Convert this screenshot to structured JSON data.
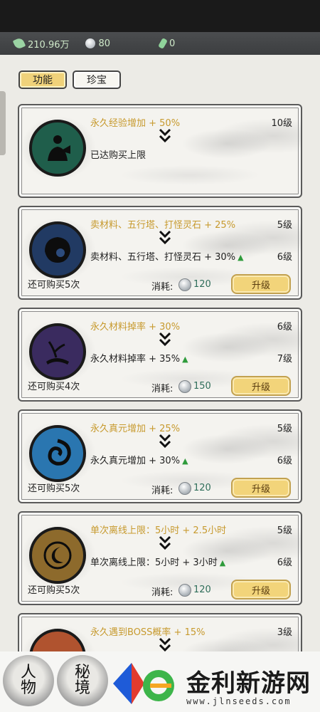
{
  "resources": [
    {
      "icon": "spirit-stone-icon",
      "value": "210.96万"
    },
    {
      "icon": "silver-stone-icon",
      "value": "80"
    },
    {
      "icon": "jade-icon",
      "value": "0"
    }
  ],
  "tabs": [
    {
      "label": "功能",
      "active": true
    },
    {
      "label": "珍宝",
      "active": false
    }
  ],
  "common": {
    "cost_label": "消耗:",
    "upgrade_label": "升级",
    "arrow_symbol": "❯❯"
  },
  "cards": [
    {
      "icon": "meditation-icon",
      "orb_color": "#1f5e4b",
      "current": "永久经验增加 + 50%",
      "current_level": "10级",
      "next": "已达购买上限",
      "next_level": "",
      "remaining": "",
      "cost": ""
    },
    {
      "icon": "shell-icon",
      "orb_color": "#213a63",
      "current": "卖材料、五行塔、打怪灵石 + 25%",
      "current_level": "5级",
      "next": "卖材料、五行塔、打怪灵石 + 30%",
      "next_level": "6级",
      "remaining": "还可购买5次",
      "cost": "120"
    },
    {
      "icon": "branch-icon",
      "orb_color": "#3a2b5f",
      "current": "永久材料掉率 + 30%",
      "current_level": "6级",
      "next": "永久材料掉率 + 35%",
      "next_level": "7级",
      "remaining": "还可购买4次",
      "cost": "150"
    },
    {
      "icon": "swirl-icon",
      "orb_color": "#2a76b0",
      "current": "永久真元增加 + 25%",
      "current_level": "5级",
      "next": "永久真元增加 + 30%",
      "next_level": "6级",
      "remaining": "还可购买5次",
      "cost": "120"
    },
    {
      "icon": "moon-clock-icon",
      "orb_color": "#8d6a2c",
      "current": "单次离线上限：5小时 + 2.5小时",
      "current_level": "5级",
      "next": "单次离线上限：5小时 + 3小时",
      "next_level": "6级",
      "remaining": "还可购买5次",
      "cost": "120"
    },
    {
      "icon": "boss-icon",
      "orb_color": "#b0532f",
      "current": "永久遇到BOSS概率 + 15%",
      "current_level": "3级",
      "next": "",
      "next_level": "",
      "remaining": "",
      "cost": ""
    }
  ],
  "bottom_nav": [
    {
      "line1": "人",
      "line2": "物"
    },
    {
      "line1": "秘",
      "line2": "境"
    }
  ],
  "watermark": {
    "text": "金利新游网",
    "url": "www.jlnseeds.com"
  }
}
